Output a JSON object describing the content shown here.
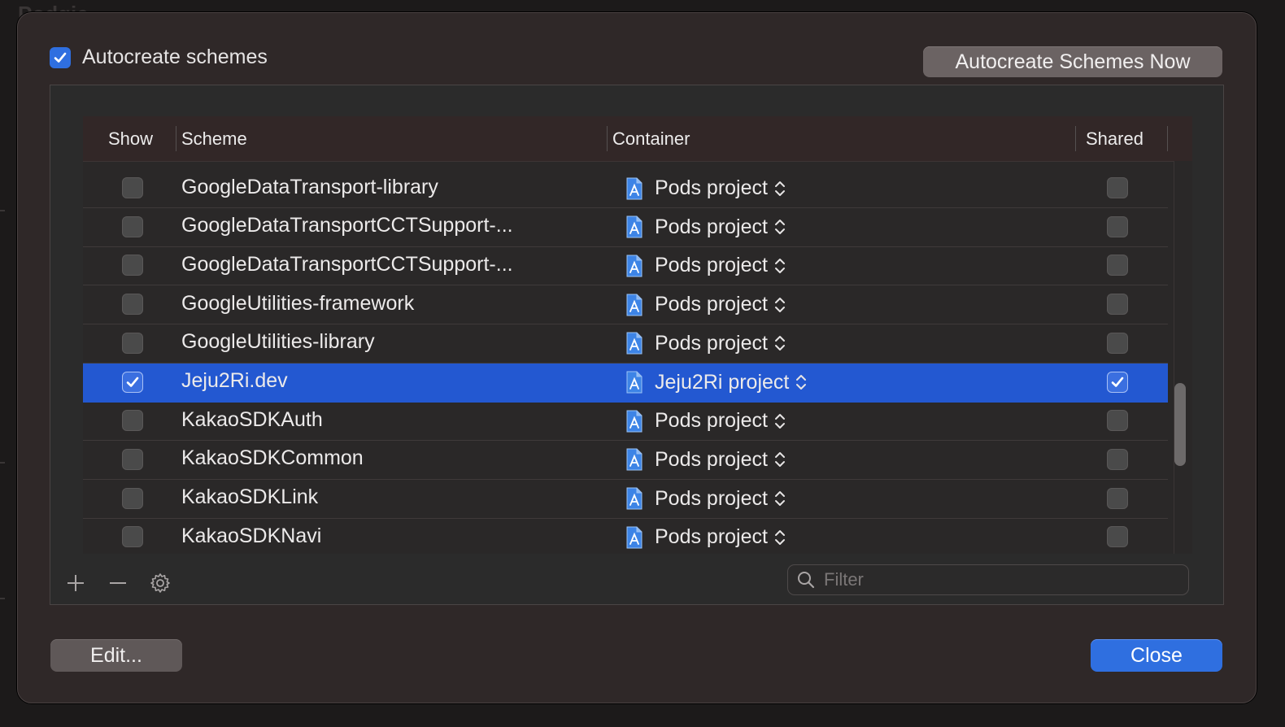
{
  "background": {
    "title": "Podgic"
  },
  "header": {
    "autocreate_checkbox_label": "Autocreate schemes",
    "autocreate_checked": true,
    "autocreate_now_label": "Autocreate Schemes Now"
  },
  "table": {
    "columns": {
      "show": "Show",
      "scheme": "Scheme",
      "container": "Container",
      "shared": "Shared"
    },
    "rows": [
      {
        "scheme": "GoogleDataTransport-library",
        "container": "Pods project",
        "show": false,
        "shared": false,
        "selected": false
      },
      {
        "scheme": "GoogleDataTransportCCTSupport-...",
        "container": "Pods project",
        "show": false,
        "shared": false,
        "selected": false
      },
      {
        "scheme": "GoogleDataTransportCCTSupport-...",
        "container": "Pods project",
        "show": false,
        "shared": false,
        "selected": false
      },
      {
        "scheme": "GoogleUtilities-framework",
        "container": "Pods project",
        "show": false,
        "shared": false,
        "selected": false
      },
      {
        "scheme": "GoogleUtilities-library",
        "container": "Pods project",
        "show": false,
        "shared": false,
        "selected": false
      },
      {
        "scheme": "Jeju2Ri.dev",
        "container": "Jeju2Ri project",
        "show": true,
        "shared": true,
        "selected": true
      },
      {
        "scheme": "KakaoSDKAuth",
        "container": "Pods project",
        "show": false,
        "shared": false,
        "selected": false
      },
      {
        "scheme": "KakaoSDKCommon",
        "container": "Pods project",
        "show": false,
        "shared": false,
        "selected": false
      },
      {
        "scheme": "KakaoSDKLink",
        "container": "Pods project",
        "show": false,
        "shared": false,
        "selected": false
      },
      {
        "scheme": "KakaoSDKNavi",
        "container": "Pods project",
        "show": false,
        "shared": false,
        "selected": false
      }
    ]
  },
  "toolbar": {
    "add_icon": "plus-icon",
    "remove_icon": "minus-icon",
    "settings_icon": "gear-icon"
  },
  "filter": {
    "placeholder": "Filter"
  },
  "footer": {
    "edit_label": "Edit...",
    "close_label": "Close"
  },
  "colors": {
    "accent": "#2f6fe0",
    "selection": "#2358d1",
    "sheet": "#2f2828"
  }
}
